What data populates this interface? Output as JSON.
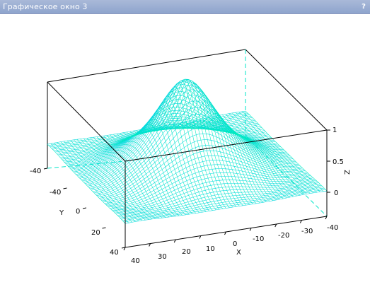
{
  "window": {
    "title": "Графическое окно 3",
    "help_glyph": "?"
  },
  "plot": {
    "type": "surface-3d-mesh",
    "mesh_color": "#00eebb",
    "box_color": "#000000",
    "axes": {
      "x": {
        "label": "X",
        "ticks": [
          "40",
          "30",
          "20",
          "10",
          "0",
          "-10",
          "-20",
          "-30",
          "-40"
        ]
      },
      "y": {
        "label": "Y",
        "ticks": [
          "-40",
          "-20",
          "0",
          "20",
          "40"
        ]
      },
      "z": {
        "label": "Z",
        "ticks": [
          "1",
          "0.5",
          "0"
        ]
      }
    },
    "z_left_tick": "-40",
    "x_right_tick": "-40"
  }
}
